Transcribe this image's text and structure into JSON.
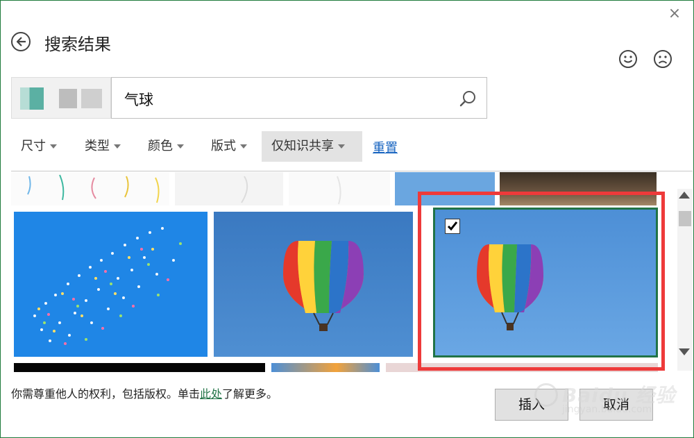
{
  "dialog": {
    "title": "搜索结果",
    "close_glyph": "×"
  },
  "search": {
    "query": "气球"
  },
  "filters": [
    {
      "label": "尺寸"
    },
    {
      "label": "类型"
    },
    {
      "label": "颜色"
    },
    {
      "label": "版式"
    },
    {
      "label": "仅知识共享"
    }
  ],
  "reset_label": "重置",
  "notice": {
    "before": "你需尊重他人的权利，包括版权。单击",
    "link": "此处",
    "after": "了解更多。"
  },
  "buttons": {
    "insert": "插入",
    "cancel": "取消"
  },
  "watermark": {
    "main": "Baidu 经验",
    "sub": "jingyan.baidu.com"
  },
  "colors": {
    "accent_green": "#217346",
    "highlight_red": "#ee3a3a",
    "link_blue": "#1764c0",
    "sky_blue": "#4d8fd6"
  },
  "results": {
    "selected_index": 2,
    "items": [
      {
        "name": "balloons-streamers-top",
        "selected": false
      },
      {
        "name": "balloons-bunch-sky",
        "selected": false
      },
      {
        "name": "hot-air-balloon-1",
        "selected": false
      },
      {
        "name": "hot-air-balloon-2",
        "selected": true
      }
    ]
  }
}
